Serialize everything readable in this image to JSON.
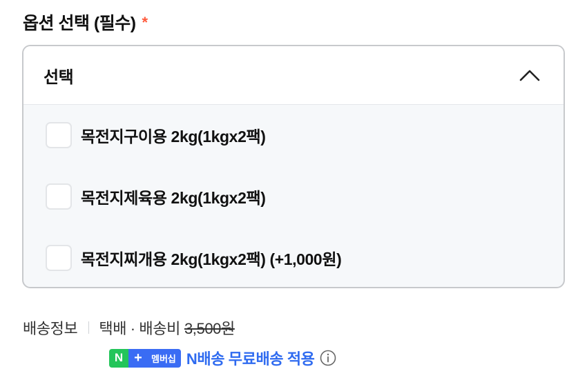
{
  "option_section": {
    "title": "옵션 선택 (필수)",
    "required_mark": "*",
    "dropdown": {
      "selected_label": "선택",
      "expanded": true,
      "options": [
        {
          "label": "목전지구이용 2kg(1kgx2팩)",
          "checked": false
        },
        {
          "label": "목전지제육용 2kg(1kgx2팩)",
          "checked": false
        },
        {
          "label": "목전지찌개용 2kg(1kgx2팩) (+1,000원)",
          "checked": false
        }
      ]
    }
  },
  "delivery": {
    "label": "배송정보",
    "method": "택배 · 배송비",
    "fee": "3,500원"
  },
  "membership": {
    "badge_n": "N",
    "badge_plus": "+",
    "badge_text": "멤버십",
    "text": "N배송 무료배송 적용"
  },
  "colors": {
    "required": "#ff5a3c",
    "membership_blue": "#2f6bf0",
    "badge_green": "#23c55a",
    "badge_blue": "#3a6cf4"
  },
  "icons": {
    "collapse": "chevron-up-icon",
    "info": "info-icon"
  }
}
